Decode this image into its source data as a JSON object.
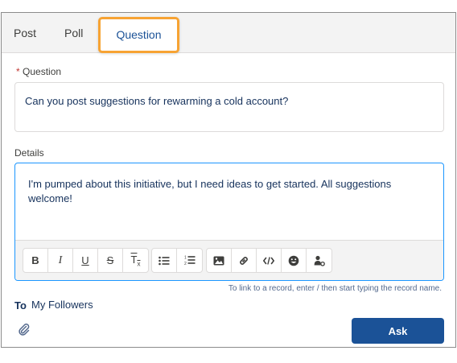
{
  "tabs": {
    "post": "Post",
    "poll": "Poll",
    "question": "Question",
    "active": "Question"
  },
  "question": {
    "required_marker": "*",
    "label": "Question",
    "value": "Can you post suggestions for rewarming a cold account?"
  },
  "details": {
    "label": "Details",
    "value": "I'm pumped about this initiative, but I need ideas to get started. All suggestions welcome!"
  },
  "toolbar": {
    "buttons": [
      "bold",
      "italic",
      "underline",
      "strikethrough",
      "remove-formatting",
      "bulleted-list",
      "numbered-list",
      "image",
      "link",
      "code",
      "emoji",
      "mention"
    ]
  },
  "hint": "To link to a record, enter / then start typing the record name.",
  "audience": {
    "to_label": "To",
    "value": "My Followers"
  },
  "actions": {
    "ask_label": "Ask"
  },
  "colors": {
    "accent": "#1b5297",
    "highlight": "#f7a333",
    "focus_border": "#1b96ff"
  }
}
